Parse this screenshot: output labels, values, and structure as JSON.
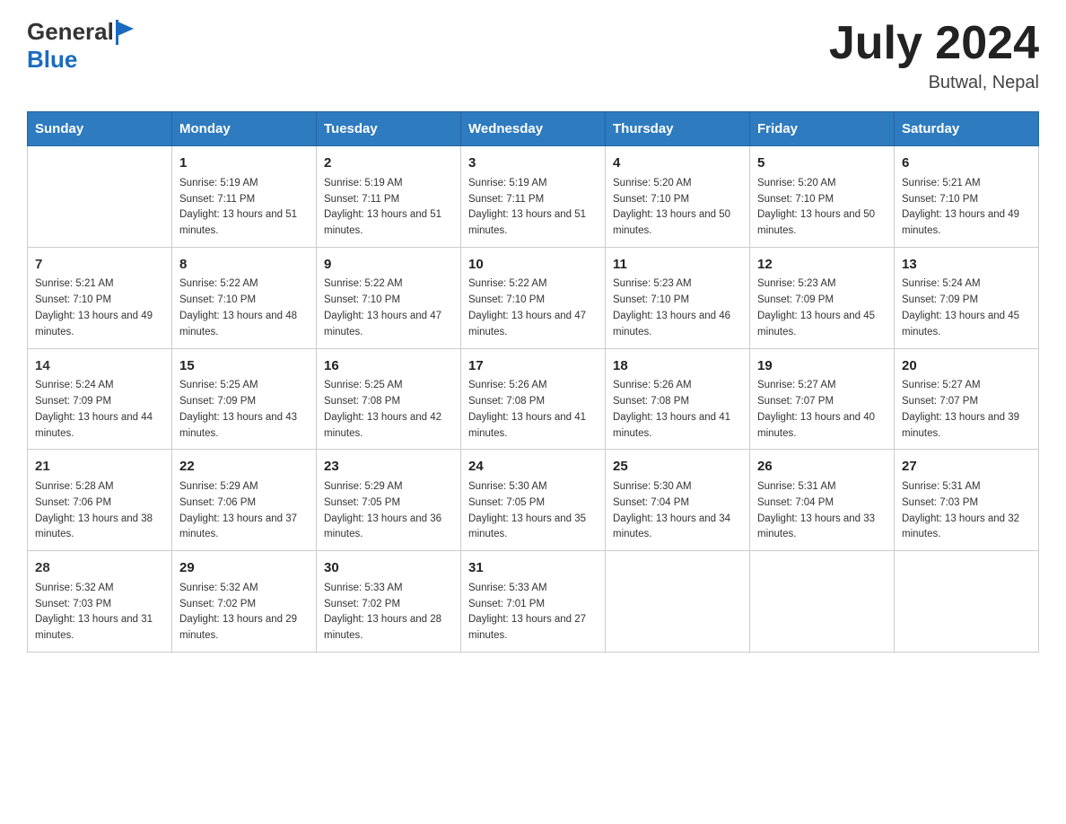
{
  "logo": {
    "general": "General",
    "blue": "Blue"
  },
  "title": {
    "month_year": "July 2024",
    "location": "Butwal, Nepal"
  },
  "columns": [
    "Sunday",
    "Monday",
    "Tuesday",
    "Wednesday",
    "Thursday",
    "Friday",
    "Saturday"
  ],
  "weeks": [
    [
      {
        "day": "",
        "sunrise": "",
        "sunset": "",
        "daylight": ""
      },
      {
        "day": "1",
        "sunrise": "Sunrise: 5:19 AM",
        "sunset": "Sunset: 7:11 PM",
        "daylight": "Daylight: 13 hours and 51 minutes."
      },
      {
        "day": "2",
        "sunrise": "Sunrise: 5:19 AM",
        "sunset": "Sunset: 7:11 PM",
        "daylight": "Daylight: 13 hours and 51 minutes."
      },
      {
        "day": "3",
        "sunrise": "Sunrise: 5:19 AM",
        "sunset": "Sunset: 7:11 PM",
        "daylight": "Daylight: 13 hours and 51 minutes."
      },
      {
        "day": "4",
        "sunrise": "Sunrise: 5:20 AM",
        "sunset": "Sunset: 7:10 PM",
        "daylight": "Daylight: 13 hours and 50 minutes."
      },
      {
        "day": "5",
        "sunrise": "Sunrise: 5:20 AM",
        "sunset": "Sunset: 7:10 PM",
        "daylight": "Daylight: 13 hours and 50 minutes."
      },
      {
        "day": "6",
        "sunrise": "Sunrise: 5:21 AM",
        "sunset": "Sunset: 7:10 PM",
        "daylight": "Daylight: 13 hours and 49 minutes."
      }
    ],
    [
      {
        "day": "7",
        "sunrise": "Sunrise: 5:21 AM",
        "sunset": "Sunset: 7:10 PM",
        "daylight": "Daylight: 13 hours and 49 minutes."
      },
      {
        "day": "8",
        "sunrise": "Sunrise: 5:22 AM",
        "sunset": "Sunset: 7:10 PM",
        "daylight": "Daylight: 13 hours and 48 minutes."
      },
      {
        "day": "9",
        "sunrise": "Sunrise: 5:22 AM",
        "sunset": "Sunset: 7:10 PM",
        "daylight": "Daylight: 13 hours and 47 minutes."
      },
      {
        "day": "10",
        "sunrise": "Sunrise: 5:22 AM",
        "sunset": "Sunset: 7:10 PM",
        "daylight": "Daylight: 13 hours and 47 minutes."
      },
      {
        "day": "11",
        "sunrise": "Sunrise: 5:23 AM",
        "sunset": "Sunset: 7:10 PM",
        "daylight": "Daylight: 13 hours and 46 minutes."
      },
      {
        "day": "12",
        "sunrise": "Sunrise: 5:23 AM",
        "sunset": "Sunset: 7:09 PM",
        "daylight": "Daylight: 13 hours and 45 minutes."
      },
      {
        "day": "13",
        "sunrise": "Sunrise: 5:24 AM",
        "sunset": "Sunset: 7:09 PM",
        "daylight": "Daylight: 13 hours and 45 minutes."
      }
    ],
    [
      {
        "day": "14",
        "sunrise": "Sunrise: 5:24 AM",
        "sunset": "Sunset: 7:09 PM",
        "daylight": "Daylight: 13 hours and 44 minutes."
      },
      {
        "day": "15",
        "sunrise": "Sunrise: 5:25 AM",
        "sunset": "Sunset: 7:09 PM",
        "daylight": "Daylight: 13 hours and 43 minutes."
      },
      {
        "day": "16",
        "sunrise": "Sunrise: 5:25 AM",
        "sunset": "Sunset: 7:08 PM",
        "daylight": "Daylight: 13 hours and 42 minutes."
      },
      {
        "day": "17",
        "sunrise": "Sunrise: 5:26 AM",
        "sunset": "Sunset: 7:08 PM",
        "daylight": "Daylight: 13 hours and 41 minutes."
      },
      {
        "day": "18",
        "sunrise": "Sunrise: 5:26 AM",
        "sunset": "Sunset: 7:08 PM",
        "daylight": "Daylight: 13 hours and 41 minutes."
      },
      {
        "day": "19",
        "sunrise": "Sunrise: 5:27 AM",
        "sunset": "Sunset: 7:07 PM",
        "daylight": "Daylight: 13 hours and 40 minutes."
      },
      {
        "day": "20",
        "sunrise": "Sunrise: 5:27 AM",
        "sunset": "Sunset: 7:07 PM",
        "daylight": "Daylight: 13 hours and 39 minutes."
      }
    ],
    [
      {
        "day": "21",
        "sunrise": "Sunrise: 5:28 AM",
        "sunset": "Sunset: 7:06 PM",
        "daylight": "Daylight: 13 hours and 38 minutes."
      },
      {
        "day": "22",
        "sunrise": "Sunrise: 5:29 AM",
        "sunset": "Sunset: 7:06 PM",
        "daylight": "Daylight: 13 hours and 37 minutes."
      },
      {
        "day": "23",
        "sunrise": "Sunrise: 5:29 AM",
        "sunset": "Sunset: 7:05 PM",
        "daylight": "Daylight: 13 hours and 36 minutes."
      },
      {
        "day": "24",
        "sunrise": "Sunrise: 5:30 AM",
        "sunset": "Sunset: 7:05 PM",
        "daylight": "Daylight: 13 hours and 35 minutes."
      },
      {
        "day": "25",
        "sunrise": "Sunrise: 5:30 AM",
        "sunset": "Sunset: 7:04 PM",
        "daylight": "Daylight: 13 hours and 34 minutes."
      },
      {
        "day": "26",
        "sunrise": "Sunrise: 5:31 AM",
        "sunset": "Sunset: 7:04 PM",
        "daylight": "Daylight: 13 hours and 33 minutes."
      },
      {
        "day": "27",
        "sunrise": "Sunrise: 5:31 AM",
        "sunset": "Sunset: 7:03 PM",
        "daylight": "Daylight: 13 hours and 32 minutes."
      }
    ],
    [
      {
        "day": "28",
        "sunrise": "Sunrise: 5:32 AM",
        "sunset": "Sunset: 7:03 PM",
        "daylight": "Daylight: 13 hours and 31 minutes."
      },
      {
        "day": "29",
        "sunrise": "Sunrise: 5:32 AM",
        "sunset": "Sunset: 7:02 PM",
        "daylight": "Daylight: 13 hours and 29 minutes."
      },
      {
        "day": "30",
        "sunrise": "Sunrise: 5:33 AM",
        "sunset": "Sunset: 7:02 PM",
        "daylight": "Daylight: 13 hours and 28 minutes."
      },
      {
        "day": "31",
        "sunrise": "Sunrise: 5:33 AM",
        "sunset": "Sunset: 7:01 PM",
        "daylight": "Daylight: 13 hours and 27 minutes."
      },
      {
        "day": "",
        "sunrise": "",
        "sunset": "",
        "daylight": ""
      },
      {
        "day": "",
        "sunrise": "",
        "sunset": "",
        "daylight": ""
      },
      {
        "day": "",
        "sunrise": "",
        "sunset": "",
        "daylight": ""
      }
    ]
  ]
}
